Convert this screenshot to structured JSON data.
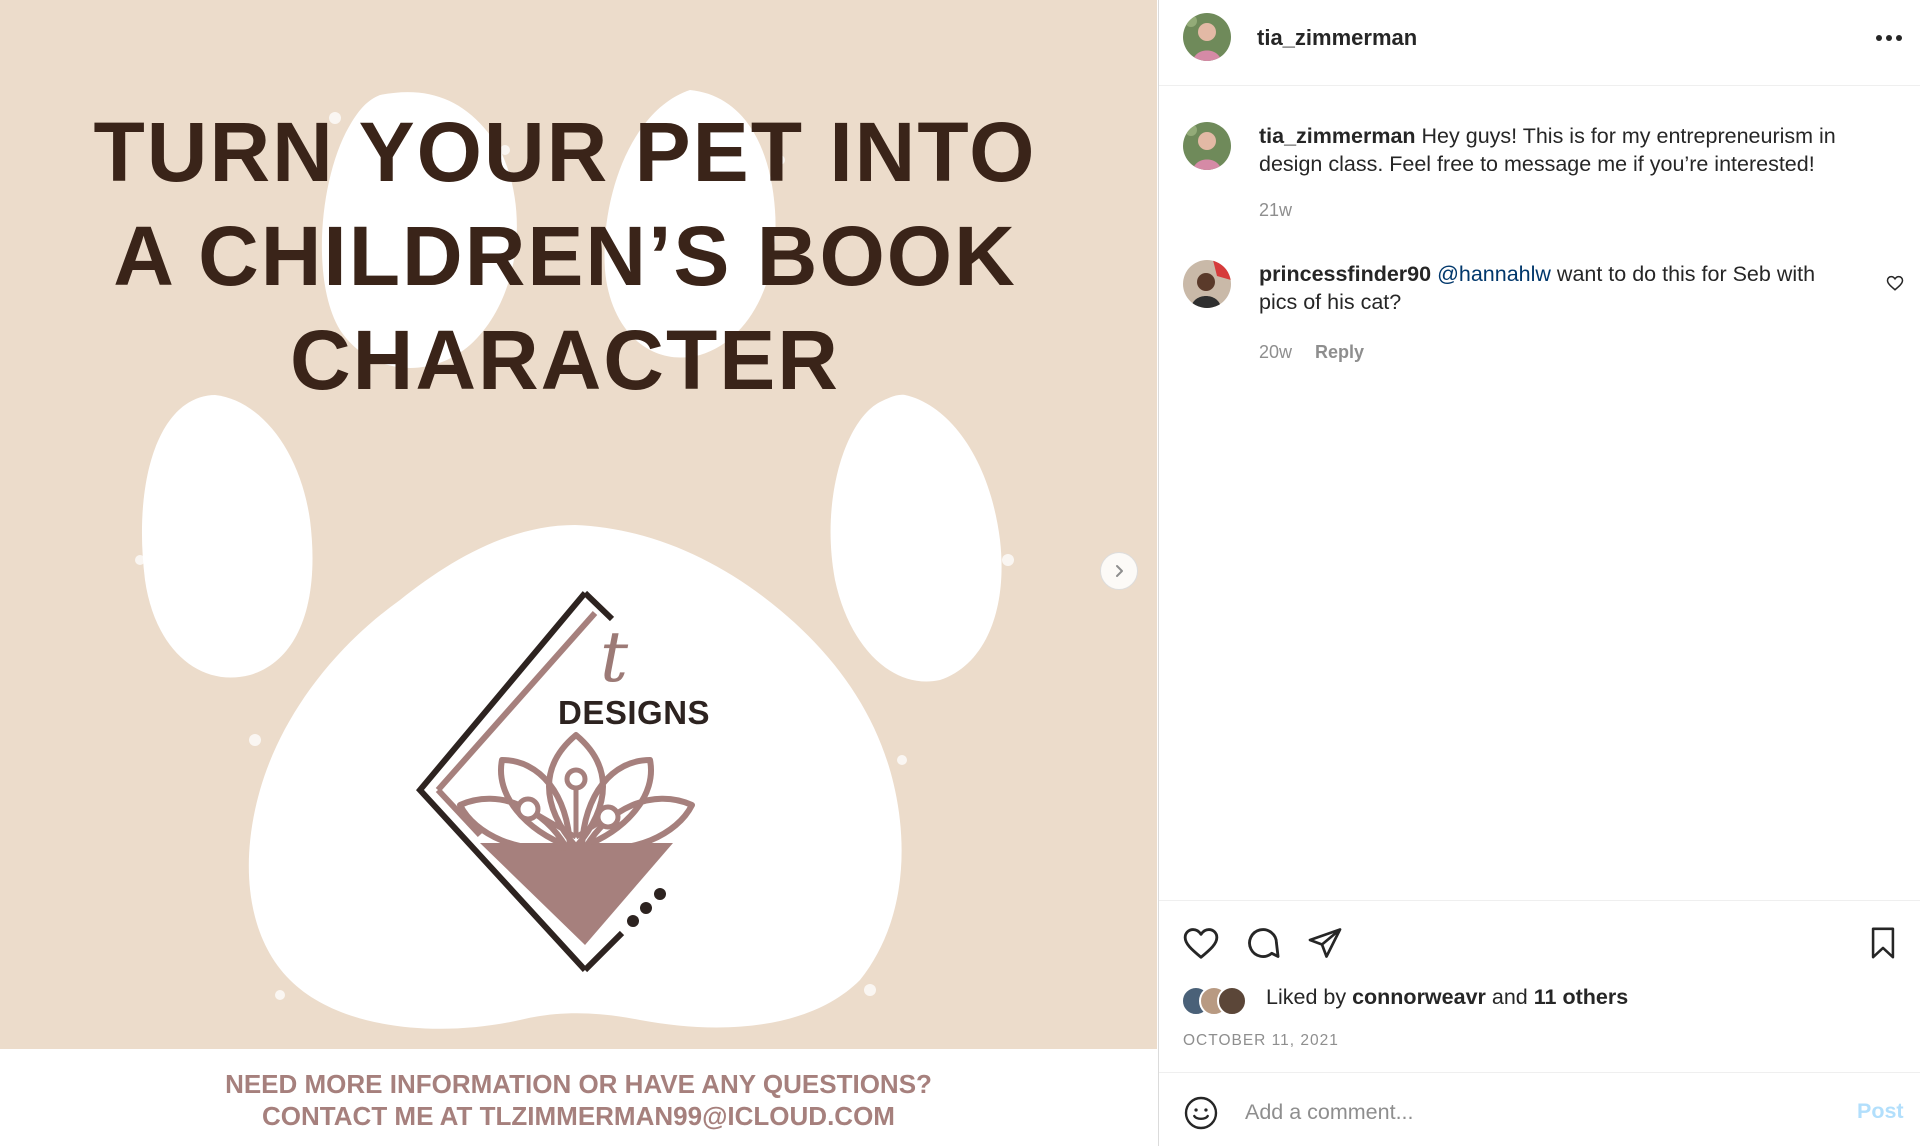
{
  "media": {
    "headline": [
      "TURN YOUR PET INTO",
      "A CHILDREN’S BOOK",
      "CHARACTER"
    ],
    "logo": {
      "script_letter": "t",
      "wordmark": "DESIGNS"
    },
    "footer": [
      "NEED MORE INFORMATION OR HAVE ANY QUESTIONS?",
      "CONTACT ME AT TLZIMMERMAN99@ICLOUD.COM"
    ],
    "colors": {
      "background": "#ecdccb",
      "headline": "#3a2419",
      "footer_text": "#a6807d",
      "logo_accent": "#a6807d"
    }
  },
  "header": {
    "username": "tia_zimmerman",
    "more_icon": "more-horizontal-icon"
  },
  "comments": [
    {
      "username": "tia_zimmerman",
      "mention": "",
      "text": "Hey guys! This is for my entrepreneurism in design class. Feel free to message me if you’re interested!",
      "time": "21w",
      "reply_label": ""
    },
    {
      "username": "princessfinder90",
      "mention": "@hannahlw",
      "text": "want to do this for Seb with pics of his cat?",
      "time": "20w",
      "reply_label": "Reply"
    }
  ],
  "actions": {
    "icons": [
      "heart-icon",
      "comment-icon",
      "share-icon",
      "bookmark-icon"
    ]
  },
  "likes": {
    "prefix": "Liked by",
    "user": "connorweavr",
    "conj": "and",
    "others": "11 others"
  },
  "post_date": "OCTOBER 11, 2021",
  "composer": {
    "placeholder": "Add a comment...",
    "post_label": "Post"
  },
  "colors": {
    "mention": "#00376b",
    "post_button": "#b2dffc",
    "muted": "#8e8e8e"
  }
}
